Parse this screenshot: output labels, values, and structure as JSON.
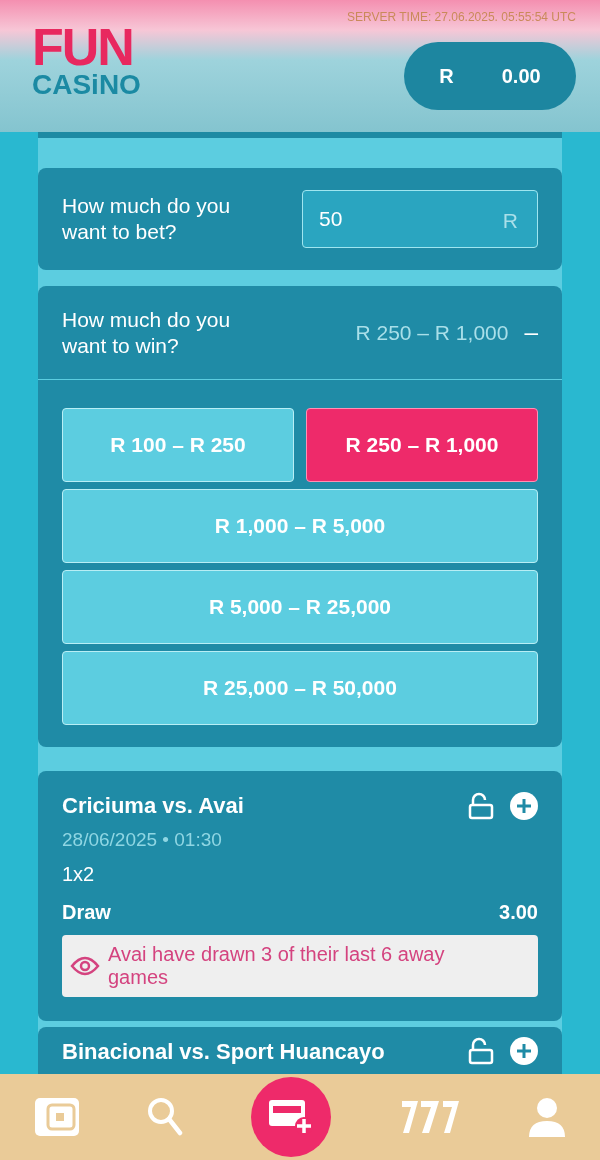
{
  "header": {
    "logo_top": "FUN",
    "logo_bottom": "CASiNO",
    "server_time": "SERVER TIME: 27.06.2025. 05:55:54 UTC",
    "balance": {
      "currency": "R",
      "amount": "0.00"
    }
  },
  "bet": {
    "question": "How much do you want to bet?",
    "value": "50",
    "currency": "R"
  },
  "win": {
    "question": "How much do you want to win?",
    "summary": "R 250 – R 1,000",
    "toggle": "–",
    "options": [
      {
        "label": "R 100 – R 250",
        "selected": false
      },
      {
        "label": "R 250 – R 1,000",
        "selected": true
      },
      {
        "label": "R 1,000 – R 5,000",
        "selected": false
      },
      {
        "label": "R 5,000 – R 25,000",
        "selected": false
      },
      {
        "label": "R 25,000 – R 50,000",
        "selected": false
      }
    ]
  },
  "matches": [
    {
      "title": "Criciuma vs. Avai",
      "datetime": "28/06/2025 • 01:30",
      "market": "1x2",
      "selection": "Draw",
      "odds": "3.00",
      "tip": "Avai have drawn 3 of their last 6 away games"
    },
    {
      "title": "Binacional vs. Sport Huancayo"
    }
  ],
  "nav": [
    {
      "kind": "wallet"
    },
    {
      "kind": "search"
    },
    {
      "kind": "betslip"
    },
    {
      "kind": "slots"
    },
    {
      "kind": "profile"
    }
  ]
}
